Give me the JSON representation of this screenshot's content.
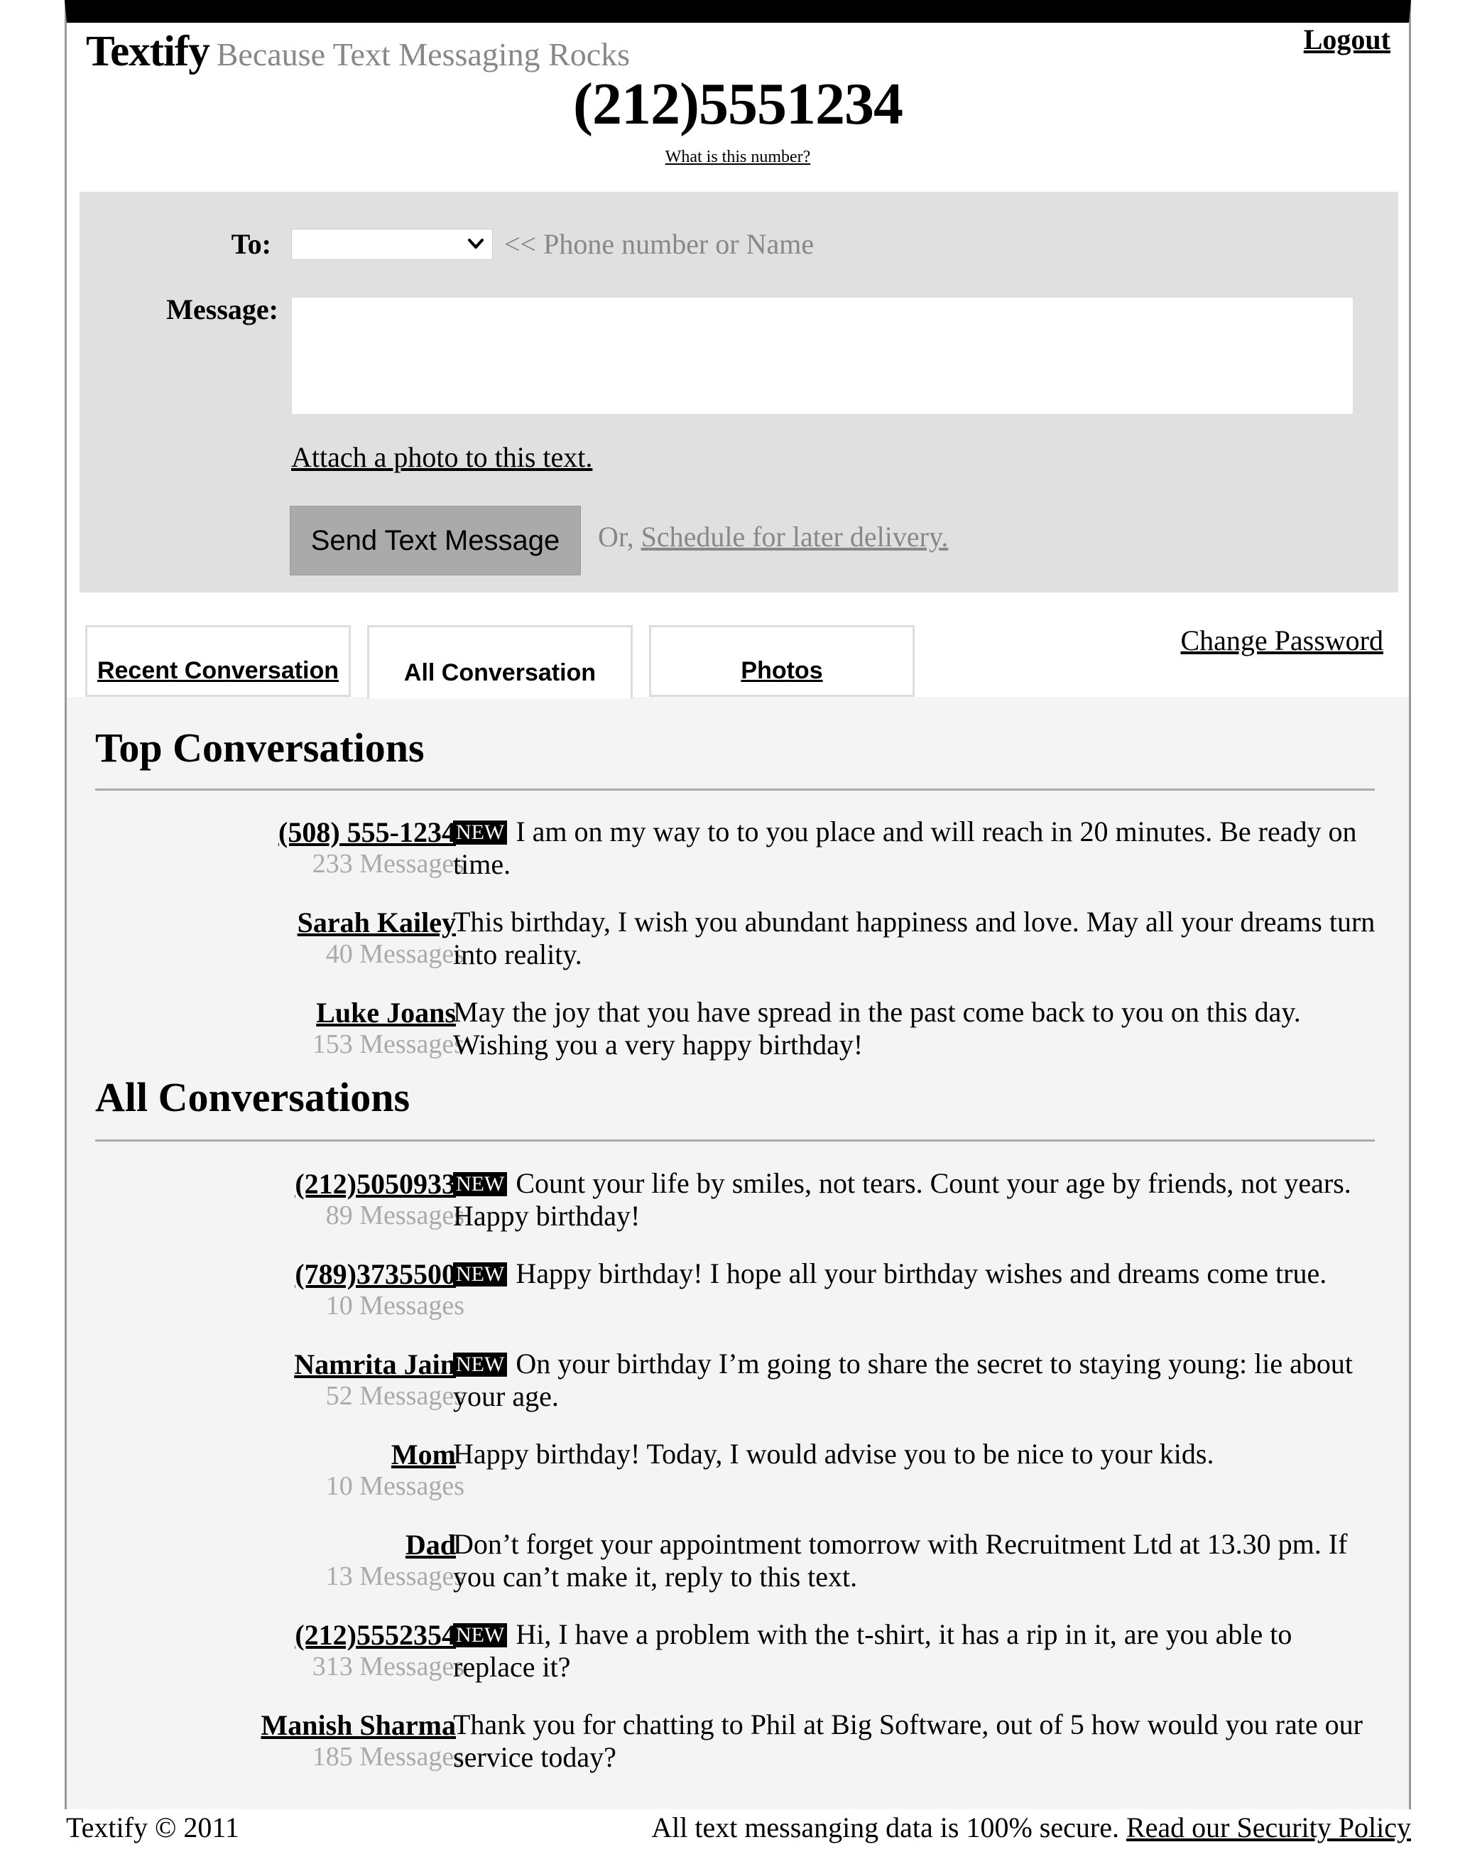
{
  "header": {
    "brand": "Textify",
    "tagline": "Because Text Messaging Rocks",
    "logout_label": "Logout",
    "phone_number": "(212)5551234",
    "what_number_label": "What is this number?"
  },
  "compose": {
    "to_label": "To:",
    "to_selected": "",
    "to_hint": "<< Phone number or Name",
    "message_label": "Message:",
    "message_value": "",
    "attach_label": "Attach a photo to this text.",
    "send_label": "Send Text Message",
    "or_label": "Or, ",
    "schedule_label": "Schedule for later delivery."
  },
  "tabs": {
    "recent": "Recent Conversation",
    "all": "All Conversation",
    "photos": "Photos"
  },
  "account": {
    "change_password_label": "Change Password"
  },
  "top_section": {
    "title": "Top Conversations",
    "rows": [
      {
        "name": "(508) 555-1234",
        "count": "233 Messages",
        "badge": "NEW",
        "message": "I am on my way to to you place and will reach in 20 minutes. Be ready on time."
      },
      {
        "name": "Sarah Kailey",
        "count": "40 Messages",
        "badge": "",
        "message": "This birthday, I wish you abundant happiness and love. May all your dreams turn into reality."
      },
      {
        "name": "Luke Joans",
        "count": "153 Messages",
        "badge": "",
        "message": "May the joy that you have spread in the past come back to you on this day. Wishing you a very happy birthday!"
      }
    ]
  },
  "all_section": {
    "title": "All Conversations",
    "rows": [
      {
        "name": "(212)5050933",
        "count": "89 Messages",
        "badge": "NEW",
        "message": "Count your life by smiles, not tears. Count your age by friends, not years. Happy birthday!"
      },
      {
        "name": "(789)3735500",
        "count": "10 Messages",
        "badge": "NEW",
        "message": "Happy birthday! I hope all your birthday wishes and dreams come true."
      },
      {
        "name": "Namrita Jain",
        "count": "52 Messages",
        "badge": "NEW",
        "message": "On your birthday I’m going to share the secret to staying young: lie about your age."
      },
      {
        "name": "Mom",
        "count": "10 Messages",
        "badge": "",
        "message": "Happy birthday! Today, I would advise you to be nice to your kids."
      },
      {
        "name": "Dad",
        "count": "13 Messages",
        "badge": "",
        "message": "Don’t forget your appointment tomorrow with Recruitment Ltd at 13.30 pm. If you can’t make it, reply to this text."
      },
      {
        "name": "(212)5552354",
        "count": "313 Messages",
        "badge": "NEW",
        "message": "Hi, I have a problem with the t-shirt, it has a rip in it, are you able to replace it?"
      },
      {
        "name": "Manish Sharma",
        "count": "185 Messages",
        "badge": "",
        "message": "Thank you for chatting to Phil at Big Software, out of 5 how would you rate our service today?"
      }
    ]
  },
  "footer": {
    "copyright": "Textify © 2011",
    "secure_text": "All text messanging data is 100% secure. ",
    "security_link": "Read our Security Policy"
  }
}
